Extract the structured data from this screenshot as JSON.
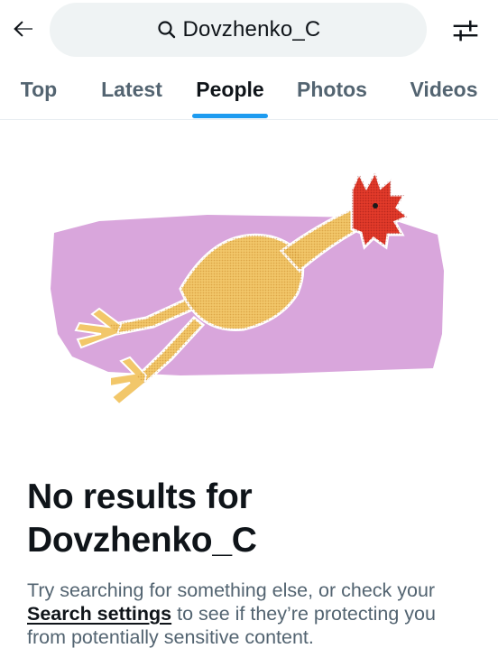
{
  "header": {
    "back_icon": "arrow-left-icon",
    "search_icon": "search-icon",
    "search_query": "Dovzhenko_C",
    "filter_icon": "sliders-icon"
  },
  "tabs": [
    {
      "label": "Top",
      "active": false
    },
    {
      "label": "Latest",
      "active": false
    },
    {
      "label": "People",
      "active": true
    },
    {
      "label": "Photos",
      "active": false
    },
    {
      "label": "Videos",
      "active": false
    }
  ],
  "accent_color": "#1d9bf0",
  "empty_state": {
    "title_line1": "No results for",
    "title_line2": "Dovzhenko_C",
    "desc_before": "Try searching for something else, or check your ",
    "desc_link": "Search settings",
    "desc_after": " to see if they’re protecting you from potentially sensitive content.",
    "illustration": "rubber-chicken-illustration"
  }
}
